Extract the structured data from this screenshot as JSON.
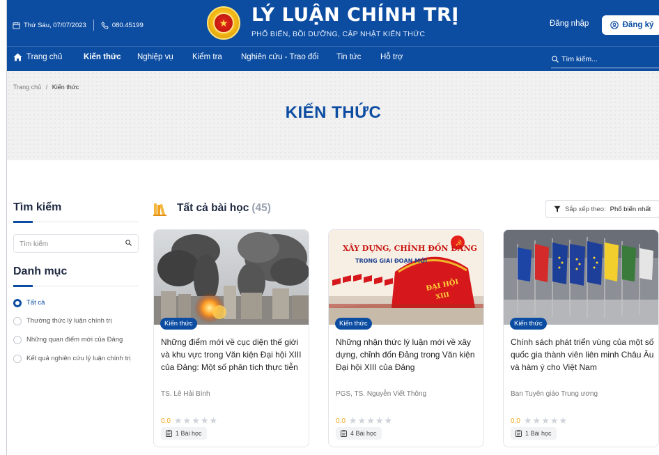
{
  "header": {
    "date": "Thứ Sáu, 07/07/2023",
    "phone": "080.45199",
    "title": "LÝ LUẬN CHÍNH TRỊ",
    "subtitle": "PHỔ BIẾN, BỒI DƯỠNG, CẬP NHẬT KIẾN THỨC",
    "login": "Đăng nhập",
    "register": "Đăng ký"
  },
  "nav": {
    "items": [
      "Trang chủ",
      "Kiến thức",
      "Nghiệp vụ",
      "Kiểm tra",
      "Nghiên cứu - Trao đổi",
      "Tin tức",
      "Hỗ trợ"
    ],
    "active": "Kiến thức",
    "search_placeholder": "Tìm kiếm..."
  },
  "breadcrumb": {
    "home": "Trang chủ",
    "separator": "/",
    "current": "Kiến thức"
  },
  "hero": {
    "title": "KIẾN THỨC"
  },
  "sidebar": {
    "search_title": "Tìm kiếm",
    "search_placeholder": "Tìm kiếm",
    "category_title": "Danh mục",
    "categories": [
      "Tất cả",
      "Thường thức lý luận chính trị",
      "Những quan điểm mới của Đảng",
      "Kết quả nghiên cứu lý luận chính trị"
    ],
    "selected_category": "Tất cả"
  },
  "list": {
    "title": "Tất cả bài học",
    "count": "(45)",
    "sort_label": "Sắp xếp theo:",
    "sort_value": "Phổ biến nhất"
  },
  "cards": [
    {
      "tag": "Kiến thức",
      "title": "Những điểm mới về cục diện thế giới và khu vực trong Văn kiện Đại hội XIII của Đảng: Một số phân tích thực tiễn",
      "author": "TS. Lê Hải Bình",
      "rating": "0.0",
      "stars": "★★★★★",
      "lessons": "1 Bài học"
    },
    {
      "tag": "Kiến thức",
      "title": "Những nhận thức lý luận mới về xây dựng, chỉnh đốn Đảng trong Văn kiện Đại hội XIII của Đảng",
      "author": "PGS, TS. Nguyễn Viết Thông",
      "rating": "0.0",
      "stars": "★★★★★",
      "lessons": "4 Bài học",
      "image_text_1": "XÂY DỰNG, CHỈNH ĐỐN ĐẢNG",
      "image_text_2": "TRONG GIAI ĐOẠN MỚI",
      "image_text_3": "ĐẠI HỘI",
      "image_text_4": "XIII"
    },
    {
      "tag": "Kiến thức",
      "title": "Chính sách phát triển vùng của một số quốc gia thành viên liên minh Châu Âu và hàm ý cho Việt Nam",
      "author": "Ban Tuyên giáo Trung ương",
      "rating": "0.0",
      "stars": "★★★★★",
      "lessons": "1 Bài học"
    }
  ],
  "colors": {
    "primary": "#0c4da2",
    "rating": "#f0a81e",
    "hero_bg": "#f1f1f1"
  }
}
